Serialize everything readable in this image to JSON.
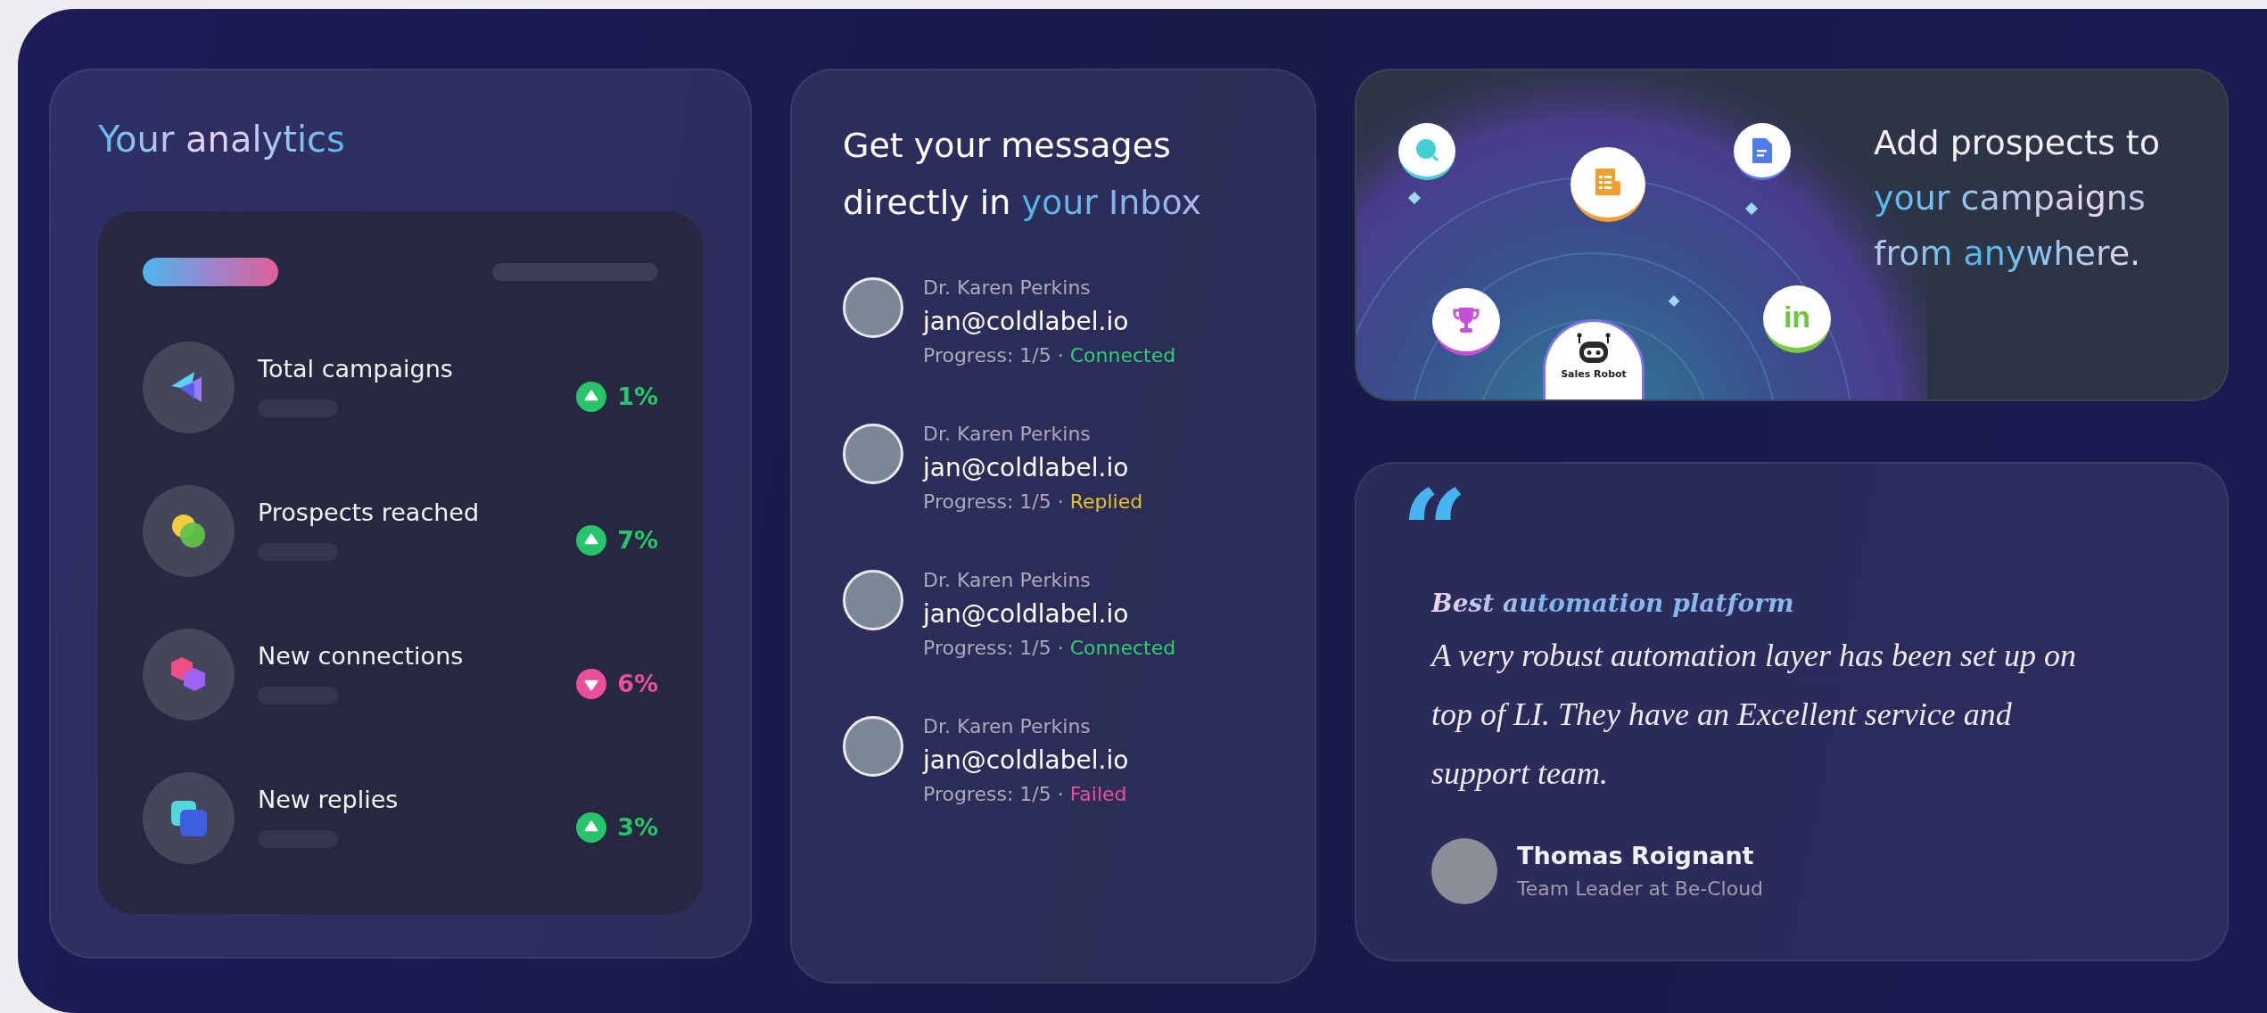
{
  "analytics": {
    "title": "Your analytics",
    "metrics": [
      {
        "label": "Total campaigns",
        "kind": "up",
        "change": "1%"
      },
      {
        "label": "Prospects reached",
        "kind": "up",
        "change": "7%"
      },
      {
        "label": "New connections",
        "kind": "down",
        "change": "6%"
      },
      {
        "label": "New replies",
        "kind": "up",
        "change": "3%"
      }
    ]
  },
  "inbox": {
    "title": "Get your messages directly in",
    "title_highlight": "your Inbox",
    "messages": [
      {
        "name": "Dr. Karen Perkins",
        "email": "jan@coldlabel.io",
        "progress": "Progress: 1/5 ·",
        "status": "Connected",
        "color": "#2fcf72"
      },
      {
        "name": "Dr. Karen Perkins",
        "email": "jan@coldlabel.io",
        "progress": "Progress: 1/5 ·",
        "status": "Replied",
        "color": "#e3c22a"
      },
      {
        "name": "Dr. Karen Perkins",
        "email": "jan@coldlabel.io",
        "progress": "Progress: 1/5 ·",
        "status": "Connected",
        "color": "#2fcf72"
      },
      {
        "name": "Dr. Karen Perkins",
        "email": "jan@coldlabel.io",
        "progress": "Progress: 1/5 ·",
        "status": "Failed",
        "color": "#e9509a"
      }
    ]
  },
  "prospects": {
    "illustration": {
      "robot_label": "Sales Robot",
      "linkedin_label": "in"
    },
    "title": "Add prospects to",
    "title_highlight": "your campaigns from anywhere."
  },
  "testimonial": {
    "quote_mark": "“",
    "title": "Best automation platform",
    "body": "A very robust automation layer has been set up on top of LI. They have an Excellent service and support team.",
    "author": "Thomas Roignant",
    "role": "Team Leader at Be-Cloud"
  }
}
